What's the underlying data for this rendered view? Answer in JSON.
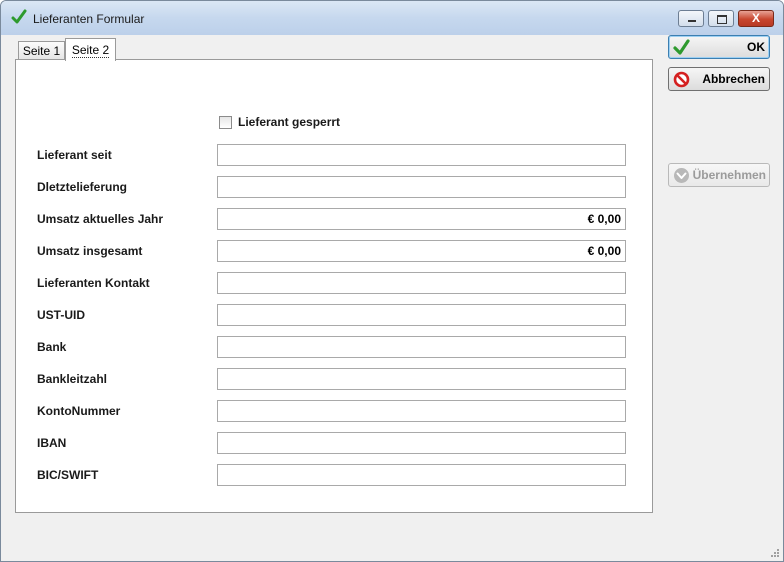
{
  "window": {
    "title": "Lieferanten Formular",
    "controls": {
      "close_glyph": "X"
    }
  },
  "tabs": [
    {
      "label": "Seite 1",
      "active": false
    },
    {
      "label": "Seite 2",
      "active": true
    }
  ],
  "form": {
    "blocked_label": "Lieferant gesperrt",
    "blocked_checked": false,
    "fields": [
      {
        "label": "Lieferant seit",
        "value": ""
      },
      {
        "label": "Dletztelieferung",
        "value": ""
      },
      {
        "label": "Umsatz aktuelles Jahr",
        "value": "€ 0,00"
      },
      {
        "label": "Umsatz insgesamt",
        "value": "€ 0,00"
      },
      {
        "label": "Lieferanten Kontakt",
        "value": ""
      },
      {
        "label": "UST-UID",
        "value": ""
      },
      {
        "label": "Bank",
        "value": ""
      },
      {
        "label": "Bankleitzahl",
        "value": ""
      },
      {
        "label": "KontoNummer",
        "value": ""
      },
      {
        "label": "IBAN",
        "value": ""
      },
      {
        "label": "BIC/SWIFT",
        "value": ""
      }
    ]
  },
  "buttons": {
    "ok": "OK",
    "cancel": "Abbrechen",
    "apply": "Übernehmen"
  },
  "icons": {
    "title": "checkmark-icon",
    "ok": "checkmark-icon",
    "cancel": "no-entry-icon",
    "apply": "arrow-down-icon"
  },
  "colors": {
    "check_green": "#2e9a2e",
    "cancel_red": "#d42020",
    "apply_gray": "#9b9b9b"
  }
}
